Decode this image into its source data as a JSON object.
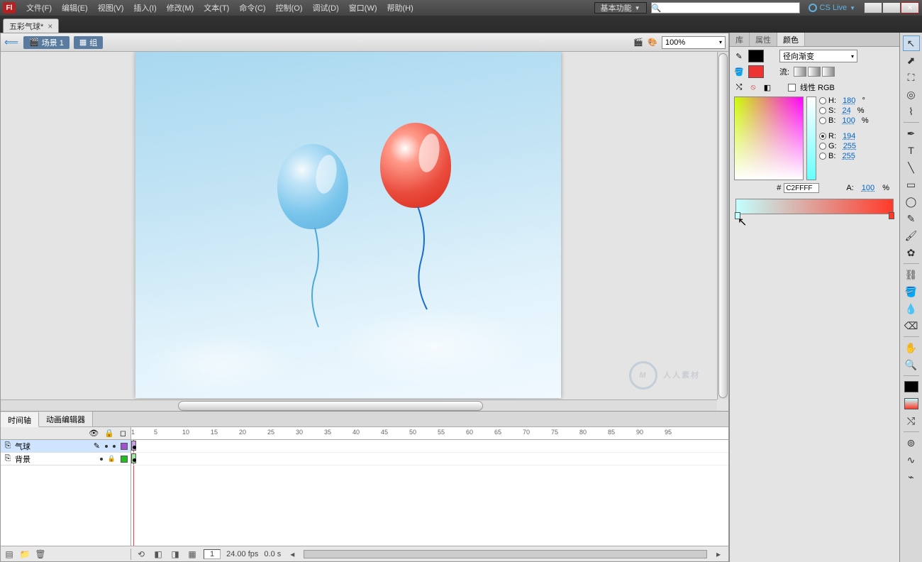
{
  "app": {
    "logo": "Fl"
  },
  "menu": [
    "文件(F)",
    "编辑(E)",
    "视图(V)",
    "插入(I)",
    "修改(M)",
    "文本(T)",
    "命令(C)",
    "控制(O)",
    "调试(D)",
    "窗口(W)",
    "帮助(H)"
  ],
  "workspace": {
    "label": "基本功能"
  },
  "cslive": {
    "label": "CS Live"
  },
  "doc_tab": {
    "title": "五彩气球*"
  },
  "editbar": {
    "scene": "场景 1",
    "symbol": "组",
    "zoom": "100%"
  },
  "timeline": {
    "tabs": [
      "时间轴",
      "动画编辑器"
    ],
    "layers": [
      {
        "name": "气球",
        "selected": true,
        "pen": true,
        "locked": false,
        "color": "#a050d0"
      },
      {
        "name": "背景",
        "selected": false,
        "pen": false,
        "locked": true,
        "color": "#20c020"
      }
    ],
    "ruler": [
      1,
      5,
      10,
      15,
      20,
      25,
      30,
      35,
      40,
      45,
      50,
      55,
      60,
      65,
      70,
      75,
      80,
      85,
      90,
      95
    ],
    "footer": {
      "frame": "1",
      "fps": "24.00 fps",
      "time": "0.0 s"
    }
  },
  "panels": {
    "tabs": [
      "库",
      "属性",
      "颜色"
    ],
    "active": "颜色",
    "color": {
      "gradient_type": "径向渐变",
      "flow_label": "流:",
      "linear_rgb": "线性 RGB",
      "hsb": {
        "H": {
          "label": "H:",
          "value": "180",
          "unit": "°"
        },
        "S": {
          "label": "S:",
          "value": "24",
          "unit": "%"
        },
        "B": {
          "label": "B:",
          "value": "100",
          "unit": "%"
        }
      },
      "rgb": {
        "R": {
          "label": "R:",
          "value": "194"
        },
        "G": {
          "label": "G:",
          "value": "255"
        },
        "Bb": {
          "label": "B:",
          "value": "255"
        }
      },
      "alpha": {
        "label": "A:",
        "value": "100",
        "unit": "%"
      },
      "hex_label": "#",
      "hex": "C2FFFF"
    }
  },
  "watermark": "人人素材"
}
